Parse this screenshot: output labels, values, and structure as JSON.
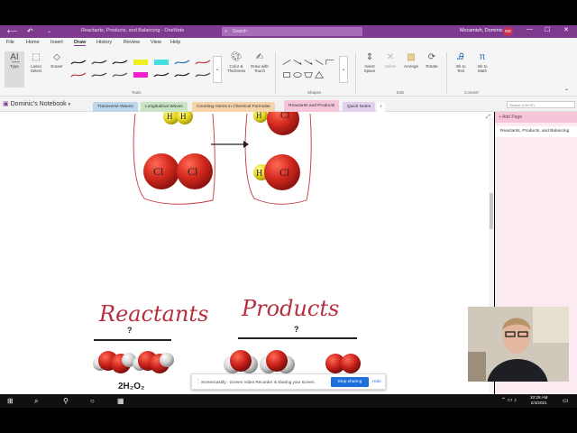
{
  "window": {
    "title": "Reactants, Products, and Balancing  -  OneNote",
    "search_placeholder": "Search",
    "user_name": "Mccamish, Dominic",
    "user_initials": "MD",
    "minimize": "—",
    "maximize": "☐",
    "close": "✕"
  },
  "menu": [
    "File",
    "Home",
    "Insert",
    "Draw",
    "History",
    "Review",
    "View",
    "Help"
  ],
  "menu_active": "Draw",
  "ribbon": {
    "type_label": "Type",
    "lasso_label": "Lasso Select",
    "eraser_label": "Eraser",
    "color_thickness_label": "Color & Thickness",
    "draw_touch_label": "Draw with Touch",
    "insert_space_label": "Insert Space",
    "delete_label": "Delete",
    "arrange_label": "Arrange",
    "rotate_label": "Rotate",
    "ink_text_label": "Ink to Text",
    "ink_math_label": "Ink to Math",
    "group_tools": "Tools",
    "group_shapes": "Shapes",
    "group_edit": "Edit",
    "group_convert": "Convert"
  },
  "notebook": {
    "name": "Dominic's Notebook",
    "tabs": [
      {
        "label": "Transverse Waves",
        "color": "#bcd7ec"
      },
      {
        "label": "Longitudinal Waves",
        "color": "#c9e4c5"
      },
      {
        "label": "Counting Atoms in Chemical Formulas",
        "color": "#f6d3a8"
      },
      {
        "label": "Reactants and Products",
        "color": "#f5c6da"
      },
      {
        "label": "Quick Notes",
        "color": "#e3d0ee"
      }
    ],
    "add_tab": "+",
    "page_search_placeholder": "Search (Ctrl+E)"
  },
  "pages": {
    "add_page": "Add Page",
    "items": [
      "Reactants, Products, and Balancing"
    ]
  },
  "content": {
    "reactants_label": "Reactants",
    "products_label": "Products",
    "question_left": "?",
    "question_right": "?",
    "formula_left": "2H₂O₂",
    "atom_cl": "Cl",
    "atom_h": "H"
  },
  "share": {
    "message": "Screencastify - Screen Video Recorder is sharing your screen.",
    "stop_label": "Stop sharing",
    "hide_label": "Hide"
  },
  "taskbar": {
    "time": "10:28 AM",
    "date": "2/4/2021"
  },
  "colors": {
    "onenote_purple": "#7d3a8f",
    "chlorine_red": "#d42a1e",
    "hydrogen_yellow": "#e8d820",
    "ink_red": "#b5303f"
  }
}
